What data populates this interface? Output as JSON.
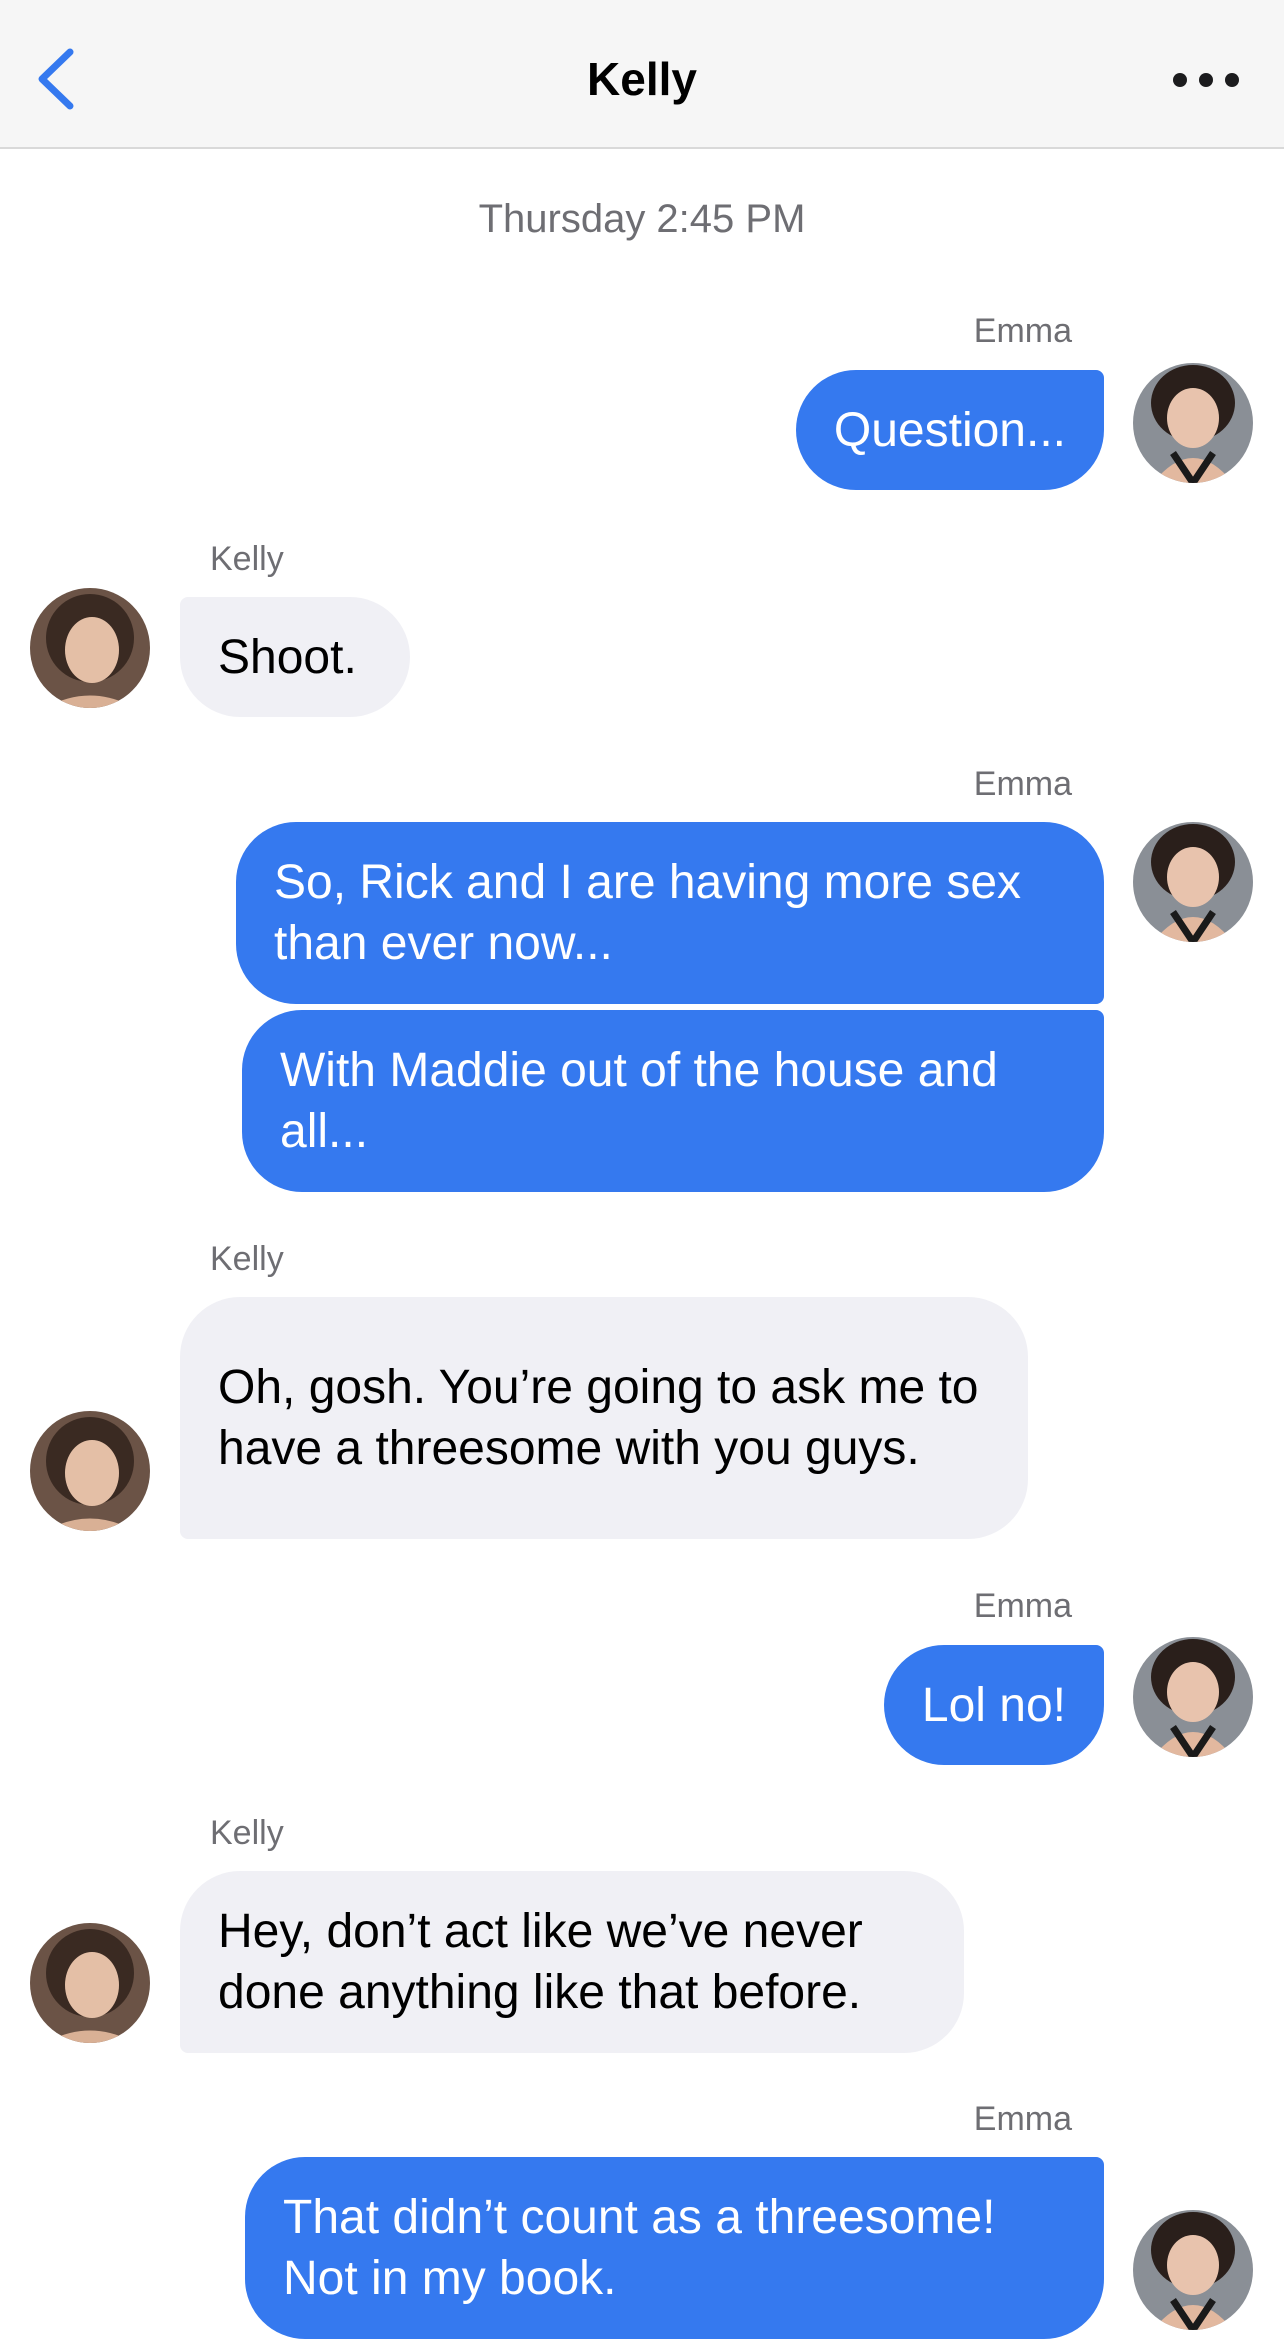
{
  "header": {
    "title": "Kelly",
    "back_icon": "chevron-left-icon",
    "more_icon": "ellipsis-icon",
    "accent_color": "#3579ef"
  },
  "conversation": {
    "timestamp": "Thursday 2:45 PM",
    "messages": [
      {
        "sender": "Emma",
        "text": "Question..."
      },
      {
        "sender": "Kelly",
        "text": "Shoot."
      },
      {
        "sender": "Emma",
        "text": "So, Rick and I are having more sex than ever now..."
      },
      {
        "sender": "Emma",
        "text": "With Maddie out of the house and all..."
      },
      {
        "sender": "Kelly",
        "text": "Oh, gosh. You’re going to ask me to have a threesome with you guys."
      },
      {
        "sender": "Emma",
        "text": "Lol no!"
      },
      {
        "sender": "Kelly",
        "text": "Hey, don’t act like we’ve never done anything like that before."
      },
      {
        "sender": "Emma",
        "text": "That didn’t count as a threesome! Not in my book."
      }
    ]
  },
  "colors": {
    "outgoing_bubble": "#3579ef",
    "incoming_bubble": "#f0f0f5",
    "secondary_text": "#6e6e73"
  }
}
